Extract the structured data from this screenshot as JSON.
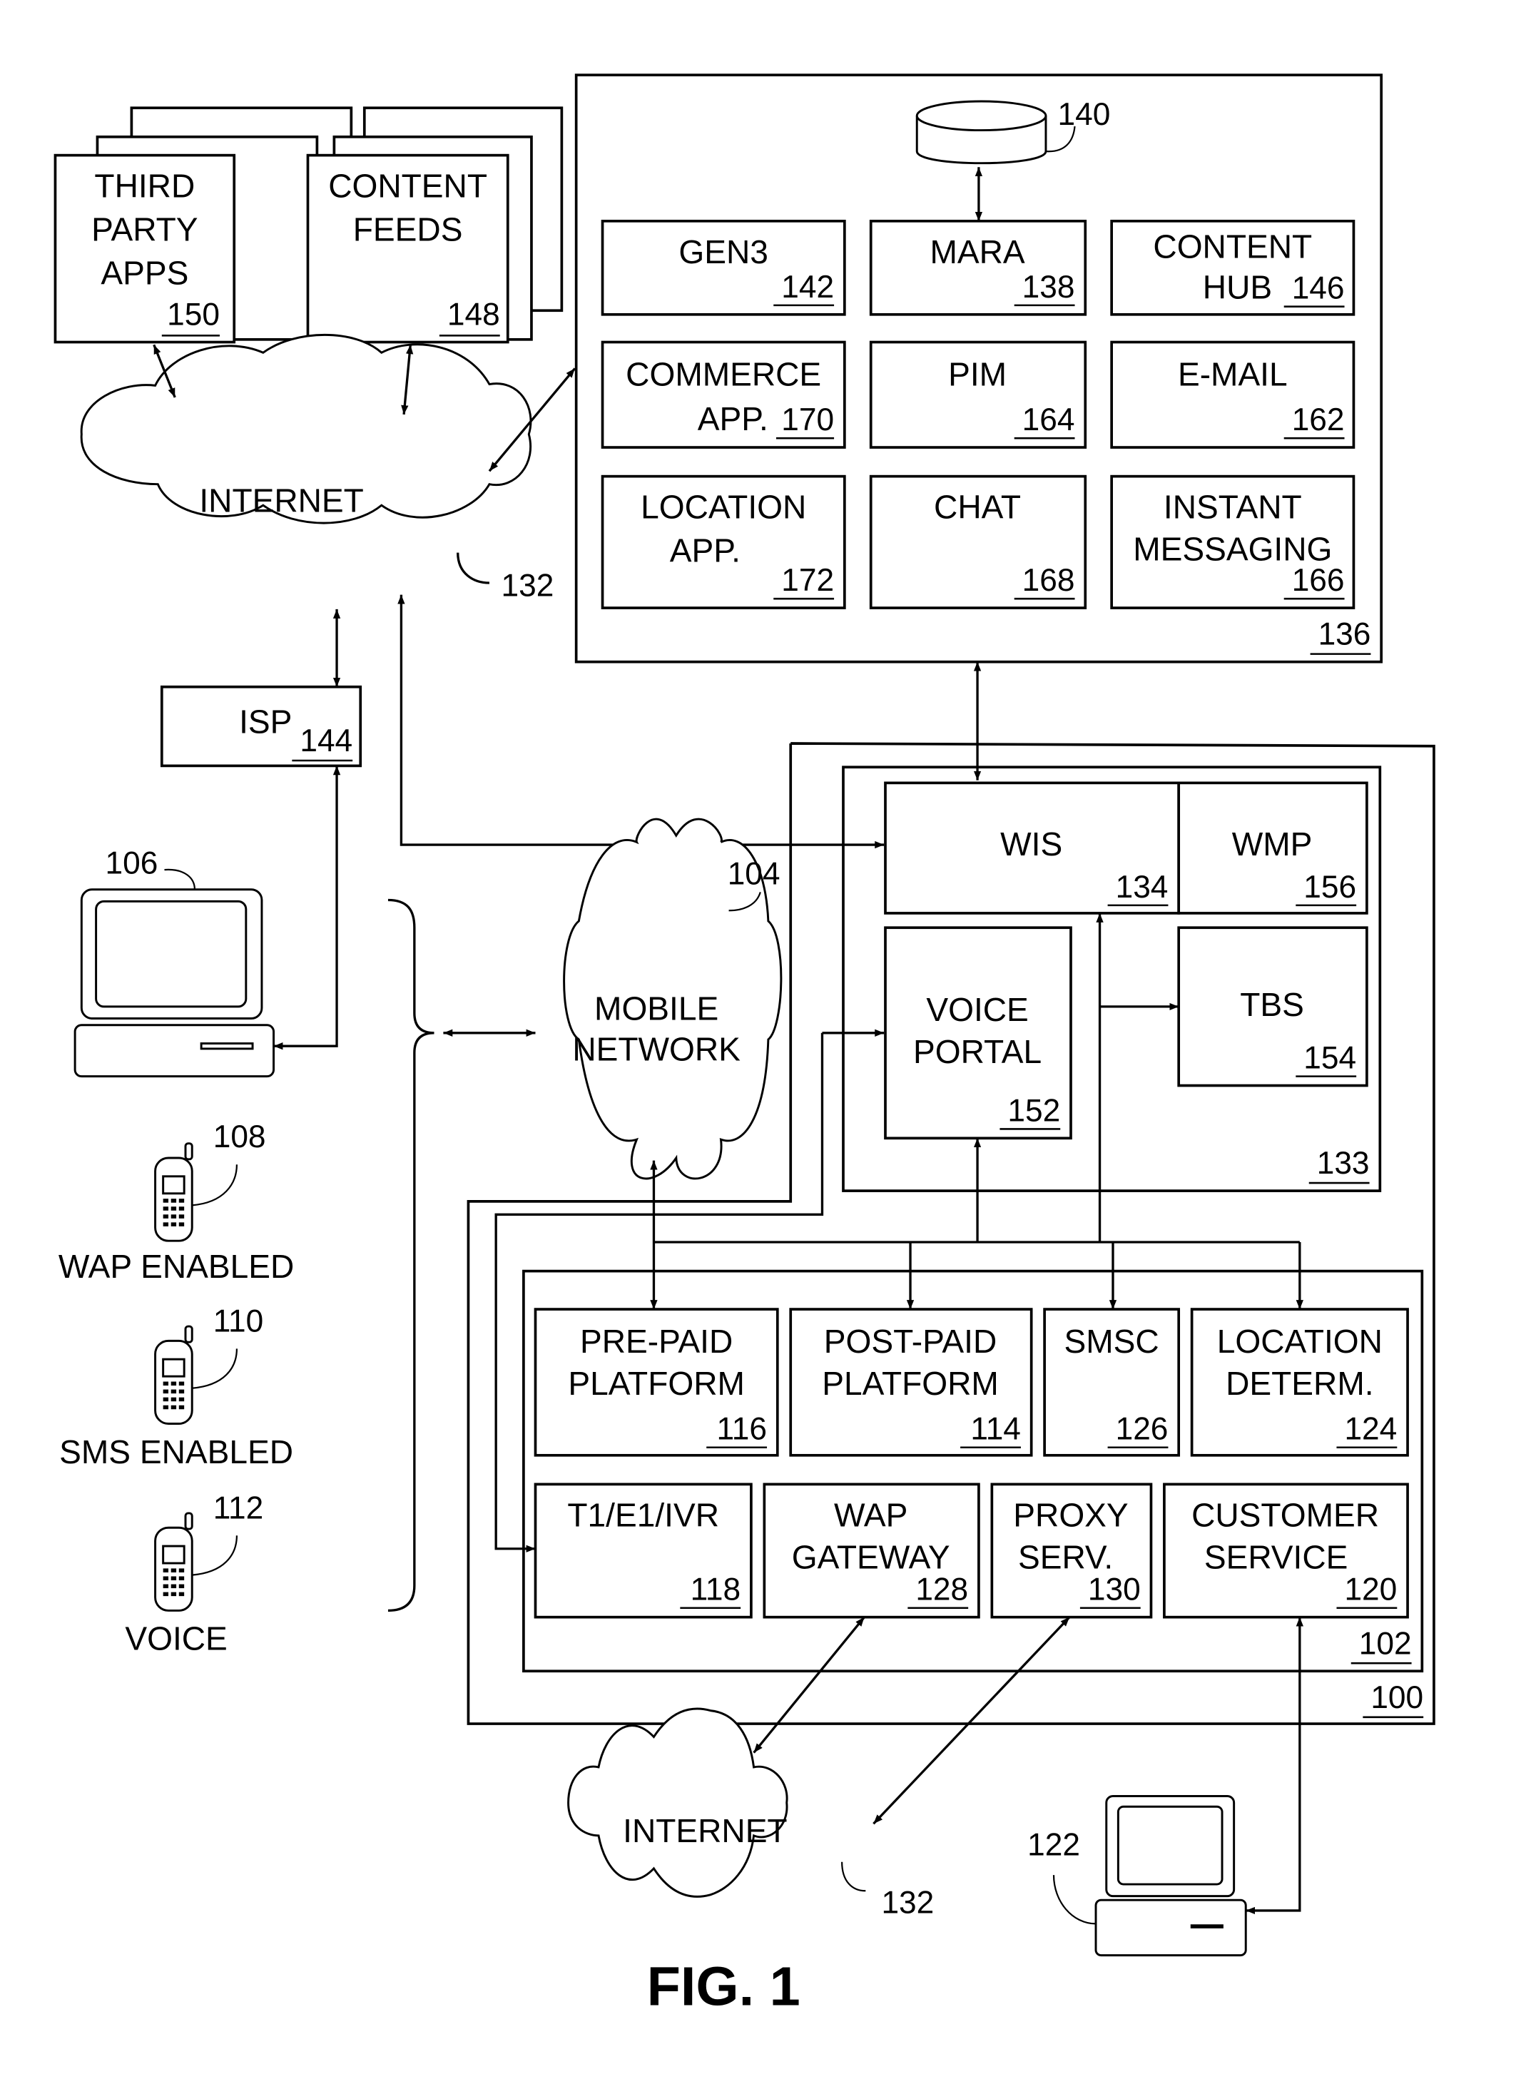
{
  "figure": {
    "caption": "FIG. 1"
  },
  "blocks": {
    "third_party_apps": {
      "lines": [
        "THIRD",
        "PARTY",
        "APPS"
      ],
      "ref": "150"
    },
    "content_feeds": {
      "lines": [
        "CONTENT",
        "FEEDS"
      ],
      "ref": "148"
    },
    "internet_top": {
      "label": "INTERNET",
      "ref": "132"
    },
    "isp": {
      "label": "ISP",
      "ref": "144"
    },
    "server_group": {
      "ref": "136"
    },
    "database": {
      "ref": "140"
    },
    "gen3": {
      "lines": [
        "GEN3"
      ],
      "ref": "142"
    },
    "mara": {
      "lines": [
        "MARA"
      ],
      "ref": "138"
    },
    "content_hub": {
      "lines": [
        "CONTENT",
        "HUB"
      ],
      "ref": "146"
    },
    "commerce_app": {
      "lines": [
        "COMMERCE",
        "APP."
      ],
      "ref": "170"
    },
    "pim": {
      "lines": [
        "PIM"
      ],
      "ref": "164"
    },
    "email": {
      "lines": [
        "E-MAIL"
      ],
      "ref": "162"
    },
    "location_app": {
      "lines": [
        "LOCATION",
        "APP."
      ],
      "ref": "172"
    },
    "chat": {
      "lines": [
        "CHAT"
      ],
      "ref": "168"
    },
    "instant_messaging": {
      "lines": [
        "INSTANT",
        "MESSAGING"
      ],
      "ref": "166"
    },
    "carrier_system": {
      "ref": "100"
    },
    "wireless_services": {
      "ref": "133"
    },
    "wis": {
      "label": "WIS",
      "ref": "134"
    },
    "wmp": {
      "label": "WMP",
      "ref": "156"
    },
    "voice_portal": {
      "lines": [
        "VOICE",
        "PORTAL"
      ],
      "ref": "152"
    },
    "tbs": {
      "label": "TBS",
      "ref": "154"
    },
    "carrier_network": {
      "ref": "102"
    },
    "pre_paid": {
      "lines": [
        "PRE-PAID",
        "PLATFORM"
      ],
      "ref": "116"
    },
    "post_paid": {
      "lines": [
        "POST-PAID",
        "PLATFORM"
      ],
      "ref": "114"
    },
    "smsc": {
      "lines": [
        "SMSC"
      ],
      "ref": "126"
    },
    "location_determ": {
      "lines": [
        "LOCATION",
        "DETERM."
      ],
      "ref": "124"
    },
    "t1e1ivr": {
      "lines": [
        "T1/E1/IVR"
      ],
      "ref": "118"
    },
    "wap_gateway": {
      "lines": [
        "WAP",
        "GATEWAY"
      ],
      "ref": "128"
    },
    "proxy_serv": {
      "lines": [
        "PROXY",
        "SERV."
      ],
      "ref": "130"
    },
    "customer_service": {
      "lines": [
        "CUSTOMER",
        "SERVICE"
      ],
      "ref": "120"
    },
    "mobile_network": {
      "lines": [
        "MOBILE",
        "NETWORK"
      ],
      "ref": "104"
    },
    "internet_bottom": {
      "label": "INTERNET",
      "ref": "132"
    },
    "computer_user": {
      "ref": "106"
    },
    "computer_service": {
      "ref": "122"
    },
    "phone_wap": {
      "label": "WAP ENABLED",
      "ref": "108"
    },
    "phone_sms": {
      "label": "SMS ENABLED",
      "ref": "110"
    },
    "phone_voice": {
      "label": "VOICE",
      "ref": "112"
    }
  }
}
